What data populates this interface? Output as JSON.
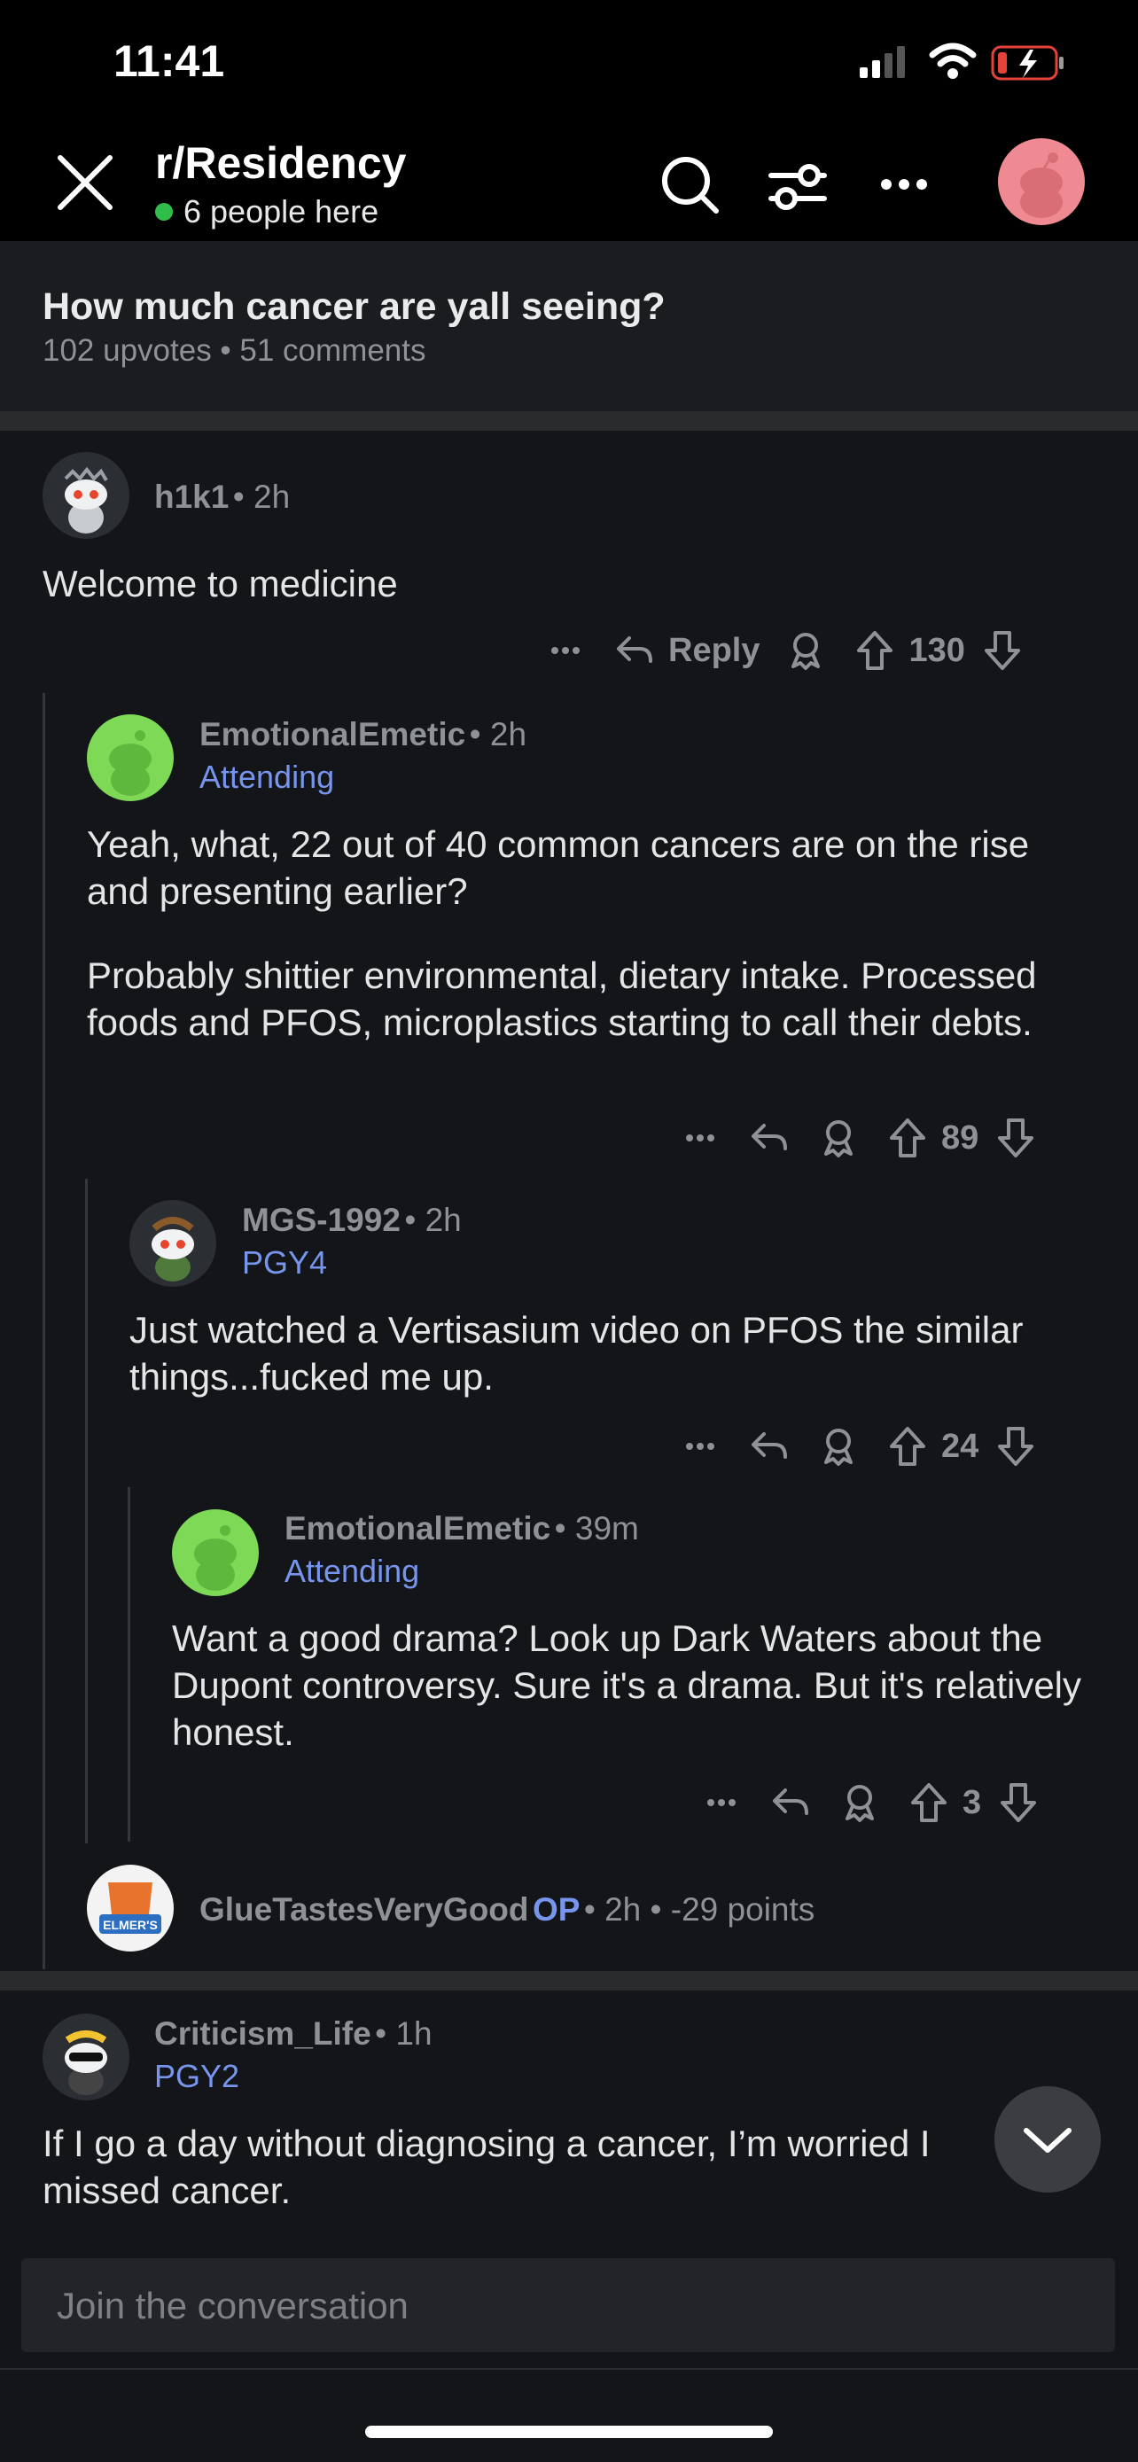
{
  "status": {
    "time": "11:41"
  },
  "header": {
    "subreddit": "r/Residency",
    "presence": "6 people here",
    "icons": [
      "close-icon",
      "search-icon",
      "filter-icon",
      "more-icon",
      "avatar"
    ]
  },
  "post": {
    "title": "How much cancer are yall seeing?",
    "meta": "102 upvotes • 51 comments"
  },
  "comments": [
    {
      "user": "h1k1",
      "time": "• 2h",
      "flair": "",
      "body": "Welcome to medicine",
      "reply_label": "Reply",
      "score": "130"
    },
    {
      "user": "EmotionalEmetic",
      "time": "• 2h",
      "flair": "Attending",
      "body1": "Yeah, what, 22 out of 40 common cancers are on the rise and presenting earlier?",
      "body2": "Probably shittier environmental, dietary intake. Processed foods and PFOS, microplastics starting to call their debts.",
      "score": "89"
    },
    {
      "user": "MGS-1992",
      "time": "• 2h",
      "flair": "PGY4",
      "body": "Just watched a Vertisasium video on PFOS the similar things...fucked me up.",
      "score": "24"
    },
    {
      "user": "EmotionalEmetic",
      "time": "• 39m",
      "flair": "Attending",
      "body": "Want a good drama? Look up Dark Waters about the Dupont controversy. Sure it's a drama. But it's relatively honest.",
      "score": "3"
    },
    {
      "user": "GlueTastesVeryGood",
      "op": "OP",
      "time": "• 2h • -29 points",
      "avatar_text": "ELMER'S"
    },
    {
      "user": "Criticism_Life",
      "time": "• 1h",
      "flair": "PGY2",
      "body": "If I go a day without diagnosing a cancer, I’m worried I missed cancer."
    }
  ],
  "composer": {
    "placeholder": "Join the conversation"
  },
  "colors": {
    "background": "#131519",
    "flair": "#7895ee",
    "presence": "#2fbe4a",
    "avatar_pink": "#f08a92",
    "avatar_green": "#7ed957"
  }
}
